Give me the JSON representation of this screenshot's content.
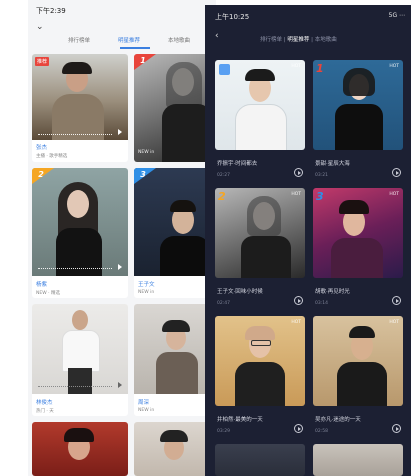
{
  "light_app": {
    "status_time": "下午2:39",
    "tabs": [
      "排行榜单",
      "明星推荐",
      "本地歌曲"
    ],
    "cards": [
      {
        "tag": "推荐",
        "name": "张杰",
        "sub": "主播 · 歌手精选"
      },
      {
        "rank": "1",
        "name": "",
        "sub": "NEW in"
      },
      {
        "rank": "2",
        "name": "杨紫",
        "sub": "NEW · 精选"
      },
      {
        "rank": "3",
        "name": "王子文",
        "sub": "NEW in"
      },
      {
        "name": "林俊杰",
        "sub": "热门 · 天"
      },
      {
        "name": "周深",
        "sub": "NEW in"
      },
      {
        "name": "",
        "sub": ""
      },
      {
        "name": "",
        "sub": ""
      }
    ]
  },
  "dark_app": {
    "status_time": "上午10:25",
    "status_right": "5G ⋯",
    "tabs": [
      "排行榜单",
      "明星推荐",
      "本地歌曲"
    ],
    "cards": [
      {
        "rank": "",
        "title": "乔振宇·时间都去",
        "time": "02:27",
        "badge": "HOT"
      },
      {
        "rank": "1",
        "title": "景甜·星辰大海",
        "time": "03:21",
        "badge": "HOT"
      },
      {
        "rank": "2",
        "title": "王子文·回味小时候",
        "time": "02:47",
        "badge": "HOT"
      },
      {
        "rank": "3",
        "title": "胡歌·再见时光",
        "time": "03:14",
        "badge": "HOT"
      },
      {
        "rank": "",
        "title": "井柏然·最美的一天",
        "time": "03:29",
        "badge": "HOT"
      },
      {
        "rank": "",
        "title": "吴亦凡·迷途的一天",
        "time": "02:58",
        "badge": "HOT"
      }
    ]
  },
  "colors": {
    "dark_bg": "#1c2033",
    "accent_blue": "#3b7fe0",
    "rank_1": "#e8453c",
    "rank_2": "#f5a623",
    "rank_3": "#2f8fe6"
  }
}
